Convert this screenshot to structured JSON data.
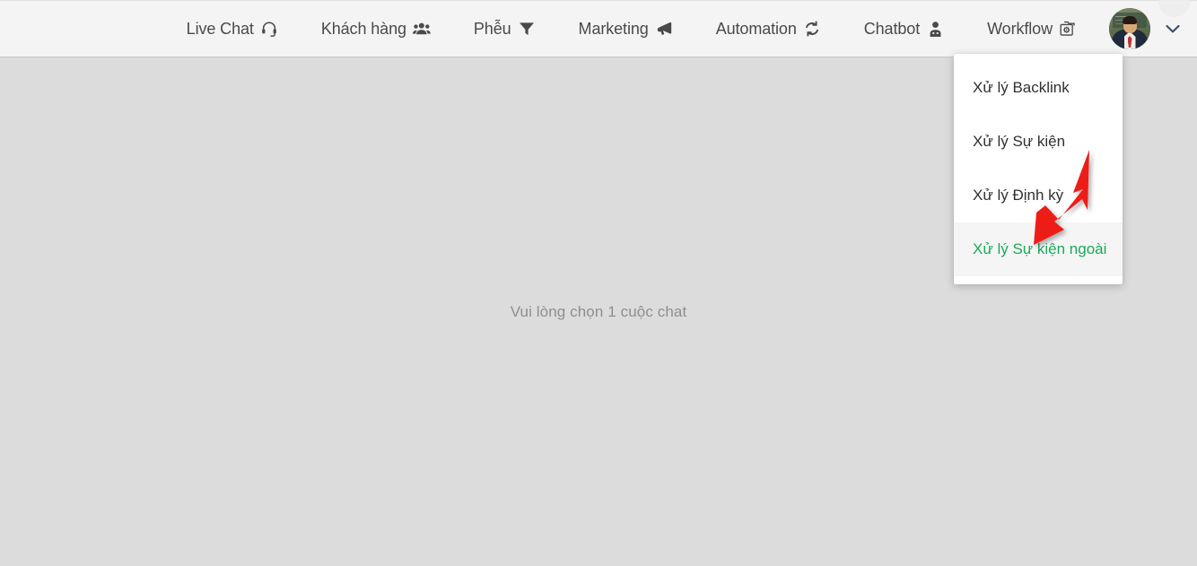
{
  "nav": {
    "items": [
      {
        "label": "Live Chat",
        "icon": "headset-icon"
      },
      {
        "label": "Khách hàng",
        "icon": "users-icon"
      },
      {
        "label": "Phễu",
        "icon": "funnel-icon"
      },
      {
        "label": "Marketing",
        "icon": "megaphone-icon"
      },
      {
        "label": "Automation",
        "icon": "sync-icon"
      },
      {
        "label": "Chatbot",
        "icon": "robot-icon"
      },
      {
        "label": "Workflow",
        "icon": "folder-gear-icon"
      }
    ],
    "avatar_alt": "user-avatar",
    "chevron_icon": "chevron-down-icon"
  },
  "dropdown": {
    "items": [
      {
        "label": "Xử lý Backlink",
        "active": false
      },
      {
        "label": "Xử lý Sự kiện",
        "active": false
      },
      {
        "label": "Xử lý Định kỳ",
        "active": false
      },
      {
        "label": "Xử lý Sự kiện ngoài",
        "active": true
      }
    ]
  },
  "main": {
    "empty_message": "Vui lòng chọn 1 cuộc chat"
  },
  "annotation": {
    "arrow_color": "#ee1c16",
    "points_to": "Xử lý Sự kiện ngoài"
  },
  "colors": {
    "nav_bg": "#f4f4f4",
    "nav_text": "#4a4a4a",
    "page_bg": "#dcdcdc",
    "menu_bg": "#ffffff",
    "menu_active_text": "#1aaa5a",
    "menu_active_bg": "#f5f5f5",
    "empty_text": "#8e8e8e"
  }
}
